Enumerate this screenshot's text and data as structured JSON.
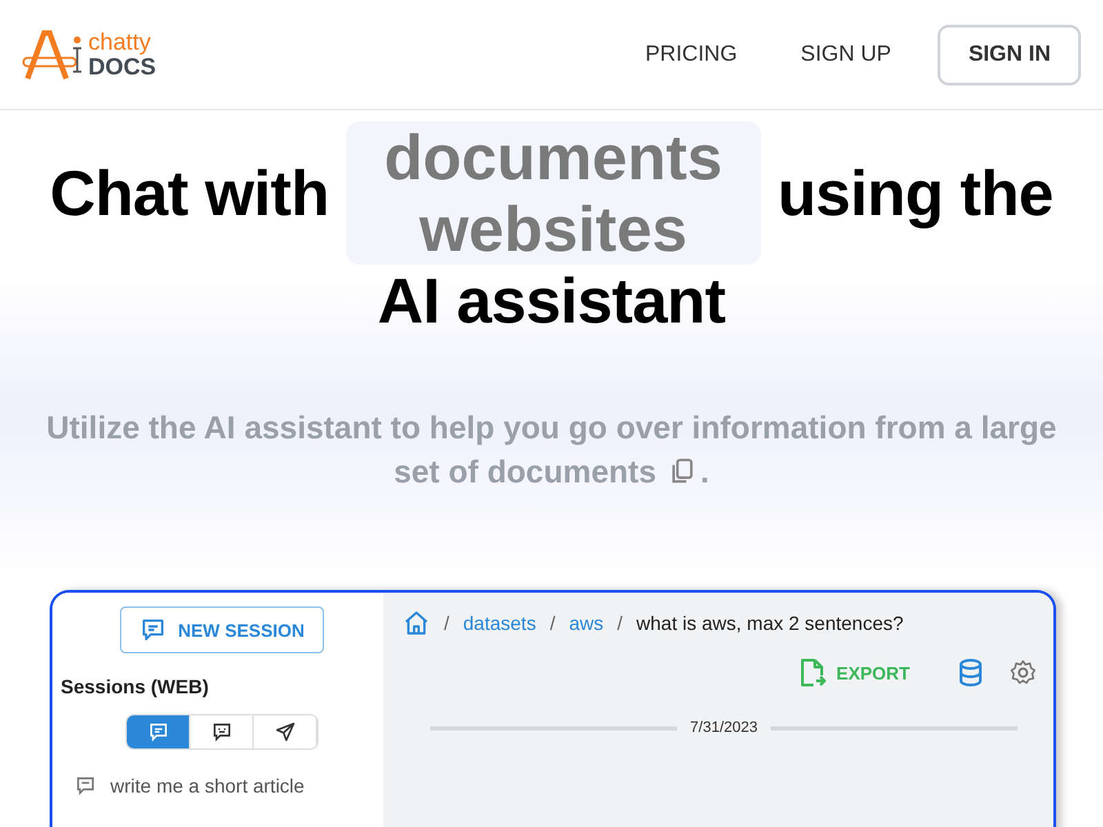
{
  "header": {
    "logo": {
      "top": "chatty",
      "bottom": "DOCS"
    },
    "nav": [
      {
        "label": "PRICING",
        "kind": "link"
      },
      {
        "label": "SIGN UP",
        "kind": "link"
      },
      {
        "label": "SIGN IN",
        "kind": "outlined"
      }
    ]
  },
  "hero": {
    "before": "Chat with",
    "rotating_words": [
      "documents",
      "websites"
    ],
    "after": "using the",
    "last_line": "AI assistant",
    "subtitle_lines": [
      "Utilize the AI assistant to help you go over information from a large",
      "set of documents"
    ],
    "subtitle_end": "."
  },
  "app_preview": {
    "new_session": "NEW SESSION",
    "sessions_title": "Sessions (WEB)",
    "session_tabs": [
      {
        "kind": "chat",
        "selected": true
      },
      {
        "kind": "bot",
        "selected": false
      },
      {
        "kind": "send",
        "selected": false
      }
    ],
    "sessions": [
      "write me a short article"
    ],
    "breadcrumb_separator": "/",
    "breadcrumb": [
      "datasets",
      "aws"
    ],
    "current": "what is aws, max 2 sentences?",
    "export": "EXPORT",
    "date": "7/31/2023"
  }
}
